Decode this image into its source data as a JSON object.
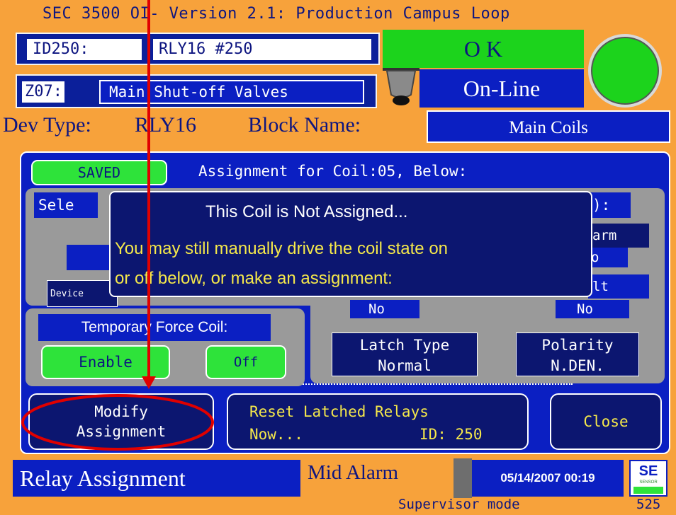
{
  "title": "SEC 3500 OI- Version 2.1: Production Campus Loop",
  "device": {
    "id_label": "ID250:",
    "id_value": "RLY16 #250",
    "zone_label": "Z07:",
    "zone_value": "Main Shut-off Valves",
    "dev_type_label": "Dev Type:",
    "dev_type_value": "RLY16",
    "block_name_label": "Block Name:",
    "block_name_value": "Main Coils"
  },
  "status": {
    "ok": "O K",
    "online": "On-Line"
  },
  "panel": {
    "saved_badge": "SAVED",
    "assignment_title": "Assignment for Coil:05, Below:",
    "select_fragment": "Sele",
    "device_fragment": "Device",
    "right_label_fragment": "):",
    "alarm_fragment": "arm",
    "alarm_value_fragment": "o",
    "latch_fragment": "lt",
    "no_left": "No",
    "no_right": "No",
    "latch_type_label": "Latch Type",
    "latch_type_value": "Normal",
    "polarity_label": "Polarity",
    "polarity_value": "N.DEN.",
    "temp_force_label": "Temporary Force Coil:",
    "enable_button": "Enable",
    "off_button": "Off"
  },
  "popup": {
    "heading": "This Coil is Not Assigned...",
    "line1": "You may still manually drive the coil state on",
    "line2": "or off below, or make an assignment:"
  },
  "buttons": {
    "modify_line1": "Modify",
    "modify_line2": "Assignment",
    "reset_line1": "Reset Latched Relays",
    "reset_line2a": "Now...",
    "reset_line2b": "ID: 250",
    "close": "Close"
  },
  "footer": {
    "screen_name": "Relay Assignment",
    "alarm_state": "Mid Alarm",
    "datetime": "05/14/2007 00:19",
    "logo": "SE",
    "logo_sub": "SENSOR",
    "mode": "Supervisor mode",
    "screen_number": "525"
  },
  "colors": {
    "frame": "#f7a23b",
    "panel_blue": "#0b1fc2",
    "navy": "#0c1670",
    "status_green": "#1cd31c",
    "annotation_red": "#e00000"
  },
  "icons": {
    "indicator": "green-status-lamp",
    "bell": "bell-icon",
    "annotation": "red-arrow-and-circle"
  }
}
